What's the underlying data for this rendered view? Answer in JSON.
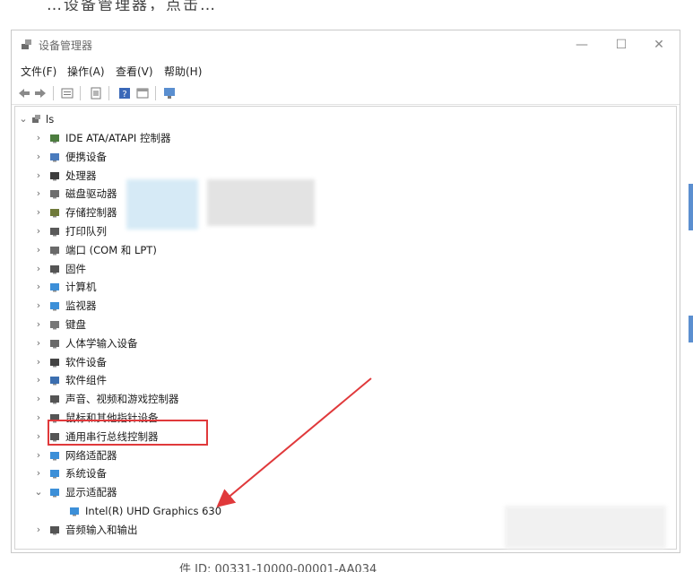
{
  "window": {
    "title": "设备管理器",
    "controls": {
      "minimize": "—",
      "maximize": "☐",
      "close": "✕"
    }
  },
  "menu": [
    "文件(F)",
    "操作(A)",
    "查看(V)",
    "帮助(H)"
  ],
  "toolbar": [
    "back-icon",
    "forward-icon",
    "properties-icon",
    "view-icon",
    "help-icon",
    "view2-icon",
    "monitor-icon"
  ],
  "tree": {
    "root": {
      "label": "ls"
    },
    "categories": [
      {
        "label": "IDE ATA/ATAPI 控制器",
        "icon": "ide-icon",
        "color": "#4c7d3f"
      },
      {
        "label": "便携设备",
        "icon": "portable-device-icon",
        "color": "#4a7bbd"
      },
      {
        "label": "处理器",
        "icon": "processor-icon",
        "color": "#3d3d3d"
      },
      {
        "label": "磁盘驱动器",
        "icon": "disk-drive-icon",
        "color": "#6d6d6d"
      },
      {
        "label": "存储控制器",
        "icon": "storage-controller-icon",
        "color": "#6f7a3a"
      },
      {
        "label": "打印队列",
        "icon": "printer-icon",
        "color": "#5a5a5a"
      },
      {
        "label": "端口 (COM 和 LPT)",
        "icon": "port-icon",
        "color": "#6a6a6a"
      },
      {
        "label": "固件",
        "icon": "firmware-icon",
        "color": "#555555"
      },
      {
        "label": "计算机",
        "icon": "computer-icon",
        "color": "#3c8fd8"
      },
      {
        "label": "监视器",
        "icon": "monitor-icon",
        "color": "#3c8fd8"
      },
      {
        "label": "键盘",
        "icon": "keyboard-icon",
        "color": "#777777"
      },
      {
        "label": "人体学输入设备",
        "icon": "hid-icon",
        "color": "#6a6a6a"
      },
      {
        "label": "软件设备",
        "icon": "software-device-icon",
        "color": "#444444"
      },
      {
        "label": "软件组件",
        "icon": "software-component-icon",
        "color": "#3c6fb0"
      },
      {
        "label": "声音、视频和游戏控制器",
        "icon": "sound-icon",
        "color": "#555555"
      },
      {
        "label": "鼠标和其他指针设备",
        "icon": "mouse-icon",
        "color": "#555555"
      },
      {
        "label": "通用串行总线控制器",
        "icon": "usb-icon",
        "color": "#555555"
      },
      {
        "label": "网络适配器",
        "icon": "network-adapter-icon",
        "color": "#3c8fd8"
      },
      {
        "label": "系统设备",
        "icon": "system-device-icon",
        "color": "#3c8fd8"
      },
      {
        "label": "显示适配器",
        "icon": "display-adapter-icon",
        "color": "#3c8fd8",
        "expanded": true
      },
      {
        "label": "Intel(R) UHD Graphics 630",
        "icon": "display-adapter-icon",
        "color": "#3c8fd8",
        "child": true
      },
      {
        "label": "音频输入和输出",
        "icon": "audio-io-icon",
        "color": "#555555"
      }
    ]
  },
  "annotation": {
    "highlight_color": "#e0393b"
  },
  "page_fragments": {
    "top": "…设备管理器，点击…",
    "bottom": "件 ID: 00331-10000-00001-AA034"
  }
}
